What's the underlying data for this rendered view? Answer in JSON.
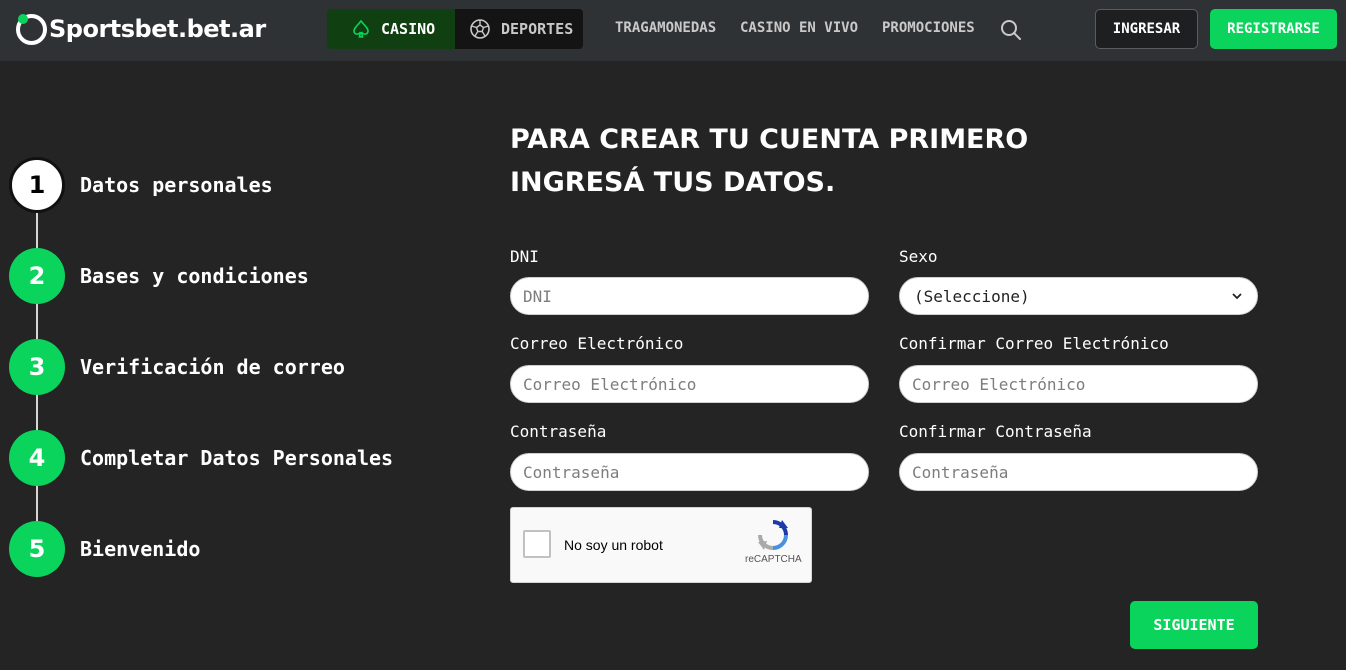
{
  "header": {
    "logo_text": "Sportsbet.bet.ar",
    "tabs": [
      {
        "label": "CASINO",
        "icon": "spade-icon",
        "active": true
      },
      {
        "label": "DEPORTES",
        "icon": "soccer-ball-icon",
        "active": false
      }
    ],
    "nav": [
      "TRAGAMONEDAS",
      "CASINO EN VIVO",
      "PROMOCIONES"
    ],
    "search_icon": "search-icon",
    "login_label": "INGRESAR",
    "register_label": "REGISTRARSE"
  },
  "steps": [
    {
      "number": "1",
      "label": "Datos personales",
      "active": true
    },
    {
      "number": "2",
      "label": "Bases y condiciones",
      "active": false
    },
    {
      "number": "3",
      "label": "Verificación de correo",
      "active": false
    },
    {
      "number": "4",
      "label": "Completar Datos Personales",
      "active": false
    },
    {
      "number": "5",
      "label": "Bienvenido",
      "active": false
    }
  ],
  "form": {
    "title_line1": "PARA CREAR TU CUENTA PRIMERO",
    "title_line2": "INGRESÁ TUS DATOS.",
    "dni": {
      "label": "DNI",
      "placeholder": "DNI",
      "value": ""
    },
    "sexo": {
      "label": "Sexo",
      "selected": "(Seleccione)"
    },
    "email": {
      "label": "Correo Electrónico",
      "placeholder": "Correo Electrónico",
      "value": ""
    },
    "email_confirm": {
      "label": "Confirmar Correo Electrónico",
      "placeholder": "Correo Electrónico",
      "value": ""
    },
    "password": {
      "label": "Contraseña",
      "placeholder": "Contraseña",
      "value": ""
    },
    "password_confirm": {
      "label": "Confirmar Contraseña",
      "placeholder": "Contraseña",
      "value": ""
    },
    "captcha": {
      "label": "No soy un robot",
      "brand": "reCAPTCHA"
    },
    "submit_label": "SIGUIENTE"
  },
  "colors": {
    "accent": "#0ad45c",
    "background": "#242424",
    "header": "#2f3235"
  }
}
